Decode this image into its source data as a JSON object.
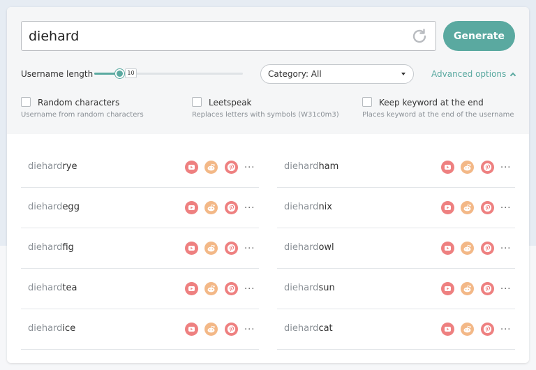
{
  "search": {
    "value": "diehard"
  },
  "generate_label": "Generate",
  "length": {
    "label": "Username length",
    "value": "10",
    "fraction": 0.17
  },
  "category": {
    "selected": "Category: All"
  },
  "advanced_label": "Advanced options",
  "options": [
    {
      "title": "Random characters",
      "desc": "Username from random characters"
    },
    {
      "title": "Leetspeak",
      "desc": "Replaces letters with symbols (W31c0m3)"
    },
    {
      "title": "Keep keyword at the end",
      "desc": "Places keyword at the end of the username"
    }
  ],
  "results": [
    {
      "keyword": "diehard",
      "suffix": "rye"
    },
    {
      "keyword": "diehard",
      "suffix": "ham"
    },
    {
      "keyword": "diehard",
      "suffix": "egg"
    },
    {
      "keyword": "diehard",
      "suffix": "nix"
    },
    {
      "keyword": "diehard",
      "suffix": "fig"
    },
    {
      "keyword": "diehard",
      "suffix": "owl"
    },
    {
      "keyword": "diehard",
      "suffix": "tea"
    },
    {
      "keyword": "diehard",
      "suffix": "sun"
    },
    {
      "keyword": "diehard",
      "suffix": "ice"
    },
    {
      "keyword": "diehard",
      "suffix": "cat"
    }
  ],
  "more_label": "...",
  "colors": {
    "accent": "#5aa9a0",
    "youtube": "#ee8080",
    "reddit": "#f3b887",
    "pinterest": "#ee8080"
  },
  "icons": [
    "refresh-icon",
    "youtube-icon",
    "reddit-icon",
    "pinterest-icon",
    "chevron-up-icon",
    "caret-down-icon"
  ]
}
